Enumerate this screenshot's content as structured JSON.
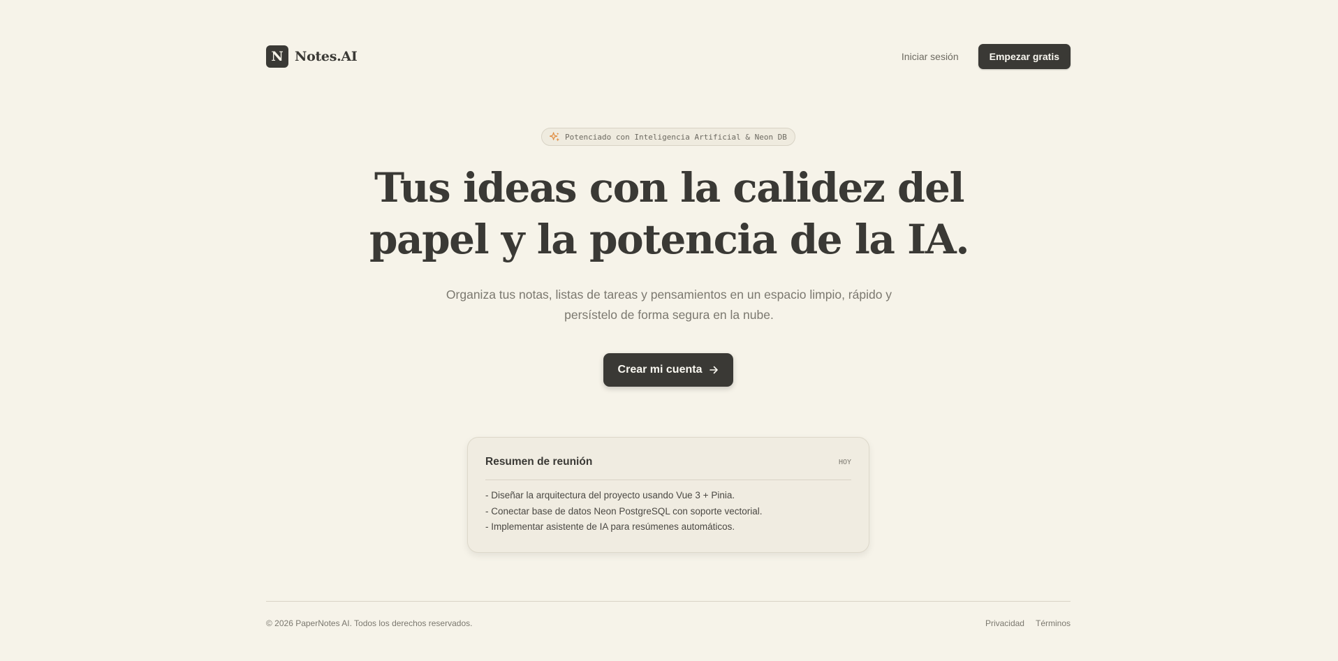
{
  "nav": {
    "logo_letter": "N",
    "brand_name": "Notes.AI",
    "login_label": "Iniciar sesión",
    "signup_label": "Empezar gratis"
  },
  "hero": {
    "badge_icon": "sparkles-icon",
    "badge_text": "Potenciado con Inteligencia Artificial & Neon DB",
    "headline_line1": "Tus ideas con la calidez del",
    "headline_line2": "papel y la potencia de la IA.",
    "subtitle_line1": "Organiza tus notas, listas de tareas y pensamientos en un espacio limpio, rápido y",
    "subtitle_line2": "persístelo de forma segura en la nube.",
    "cta_label": "Crear mi cuenta",
    "cta_icon": "arrow-right-icon"
  },
  "note_card": {
    "title": "Resumen de reunión",
    "date": "HOY",
    "lines": [
      "- Diseñar la arquitectura del proyecto usando Vue 3 + Pinia.",
      "- Conectar base de datos Neon PostgreSQL con soporte vectorial.",
      "- Implementar asistente de IA para resúmenes automáticos."
    ]
  },
  "footer": {
    "copyright": "© 2026 PaperNotes AI. Todos los derechos reservados.",
    "links": [
      "Privacidad",
      "Términos"
    ]
  },
  "colors": {
    "background": "#f6f3e9",
    "ink": "#3a3935",
    "muted": "#7b786f",
    "accent": "#e08a3c"
  }
}
